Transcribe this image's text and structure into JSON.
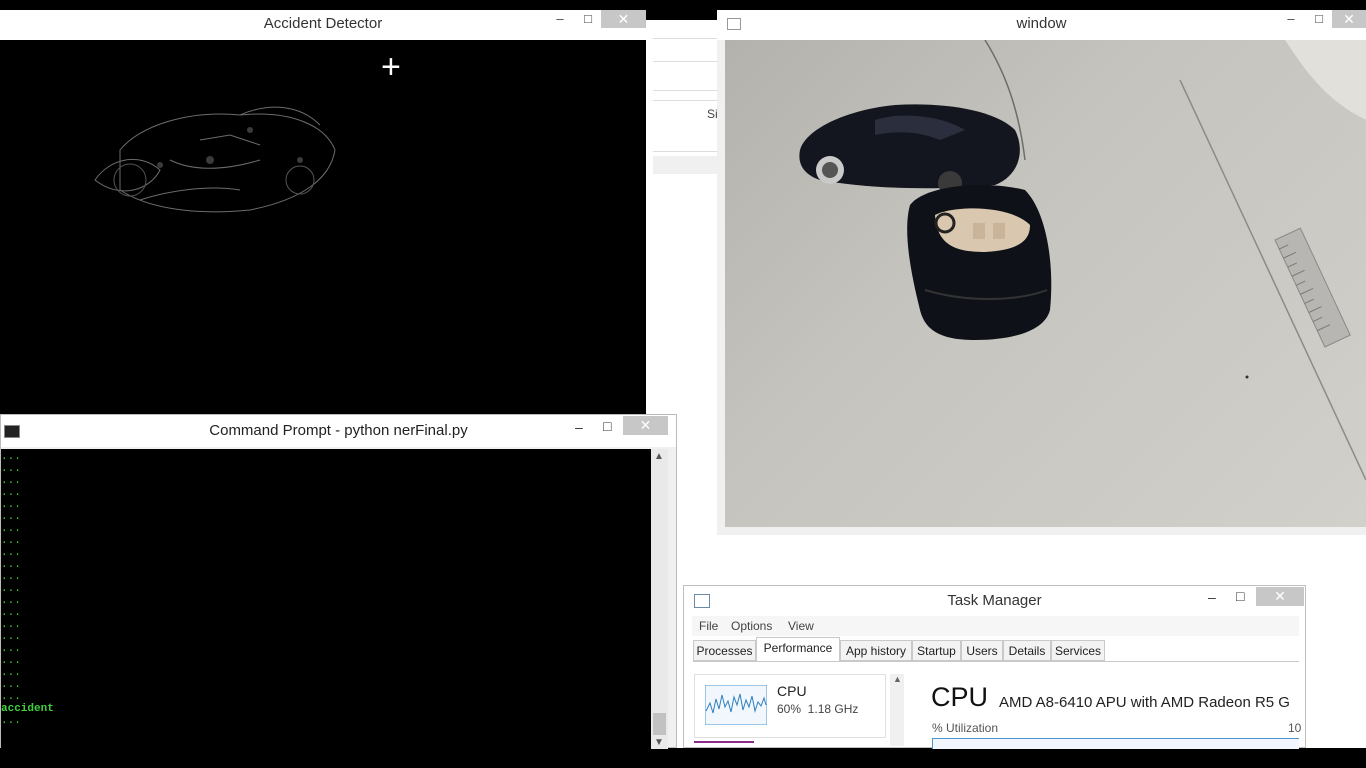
{
  "accident_window": {
    "title": "Accident Detector",
    "minimize": "–",
    "maximize": "□",
    "close": "✕",
    "cursor": "+"
  },
  "video_window": {
    "title": "window",
    "minimize": "–",
    "maximize": "□",
    "close": "✕"
  },
  "strip": {
    "label": "Si"
  },
  "cmd": {
    "title": "Command Prompt - python  nerFinal.py",
    "minimize": "–",
    "maximize": "□",
    "close": "✕",
    "lines": [
      "...",
      "...",
      "...",
      "...",
      "...",
      "...",
      "...",
      "...",
      "...",
      "...",
      "...",
      "...",
      "...",
      "...",
      "...",
      "...",
      "...",
      "...",
      "...",
      "...",
      "...",
      "accident",
      "..."
    ]
  },
  "task_manager": {
    "title": "Task Manager",
    "minimize": "–",
    "maximize": "□",
    "close": "✕",
    "menu": [
      "File",
      "Options",
      "View"
    ],
    "tabs": [
      "Processes",
      "Performance",
      "App history",
      "Startup",
      "Users",
      "Details",
      "Services"
    ],
    "cpu_card": {
      "label": "CPU",
      "stats": "60%  1.18 GHz"
    },
    "heading": "CPU",
    "processor": "AMD A8-6410 APU with AMD Radeon R5 G",
    "utilization_label": "% Utilization",
    "utilization_max": "10"
  },
  "colors": {
    "console_text": "#3ed13e",
    "close_bg": "#c7c7c7",
    "tab_active": "#ffffff"
  }
}
